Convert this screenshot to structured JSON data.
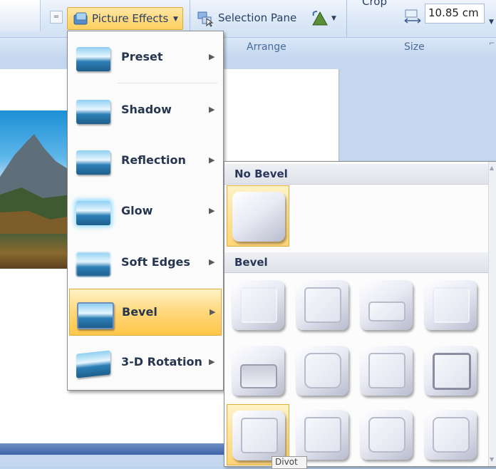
{
  "ribbon": {
    "picture_effects_label": "Picture Effects",
    "selection_pane_label": "Selection Pane",
    "crop_label": "Crop",
    "width_value": "10.85 cm",
    "groups": {
      "arrange": "Arrange",
      "size": "Size"
    }
  },
  "menu": {
    "items": [
      {
        "label": "Preset"
      },
      {
        "label": "Shadow"
      },
      {
        "label": "Reflection"
      },
      {
        "label": "Glow"
      },
      {
        "label": "Soft Edges"
      },
      {
        "label": "Bevel"
      },
      {
        "label": "3-D Rotation"
      }
    ],
    "active_item": "Bevel"
  },
  "gallery": {
    "no_bevel_header": "No Bevel",
    "bevel_header": "Bevel",
    "tooltip": "Divot"
  },
  "colors": {
    "accent_highlight": "#ffd77a",
    "ribbon": "#d9e6f6"
  }
}
